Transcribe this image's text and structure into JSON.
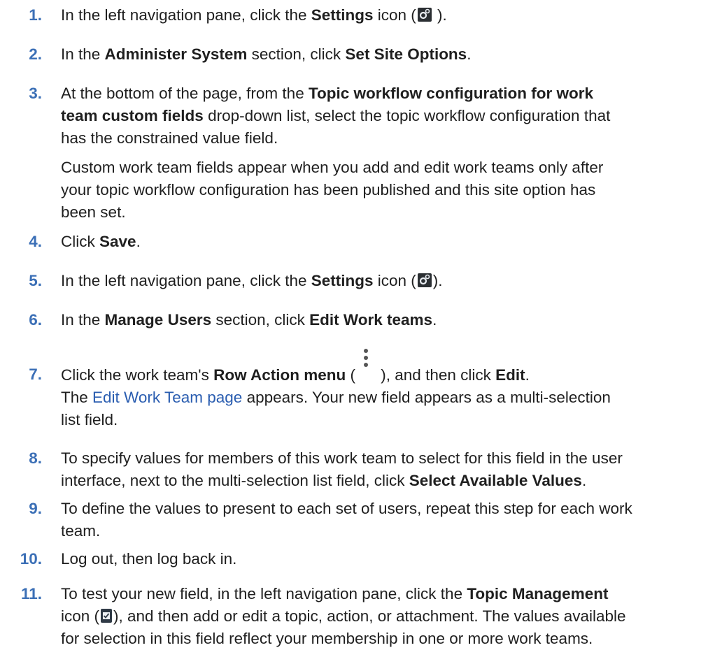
{
  "steps": [
    {
      "num": "1.",
      "parts": [
        "In the left navigation pane, click the ",
        "Settings",
        " icon (",
        " )."
      ]
    },
    {
      "num": "2.",
      "parts": [
        "In the ",
        "Administer System",
        " section, click ",
        "Set Site Options",
        "."
      ]
    },
    {
      "num": "3.",
      "line1": [
        "At the bottom of the page, from the ",
        "Topic workflow configuration for work"
      ],
      "line2": [
        "team custom fields",
        " drop-down list, select the topic workflow configuration that"
      ],
      "line3": "has the constrained value field.",
      "note": [
        "Custom work team fields appear when you add and edit work teams only after",
        "your topic workflow configuration has been published and this site option has",
        "been set."
      ]
    },
    {
      "num": "4.",
      "parts": [
        "Click ",
        "Save",
        "."
      ]
    },
    {
      "num": "5.",
      "parts": [
        "In the left navigation pane, click the ",
        "Settings",
        " icon (",
        ")."
      ]
    },
    {
      "num": "6.",
      "parts": [
        "In the ",
        "Manage Users",
        " section, click ",
        "Edit Work teams",
        "."
      ]
    },
    {
      "num": "7.",
      "parts": [
        "Click the work team's ",
        "Row Action menu",
        " (",
        " ), and then click ",
        "Edit",
        "."
      ],
      "after": [
        "The ",
        "Edit Work Team page",
        " appears. Your new field appears as a multi-selection"
      ],
      "after2": "list field."
    },
    {
      "num": "8.",
      "line1": "To specify values for members of this work team to select for this field in the user",
      "line2": [
        "interface, next to the multi-selection list field, click ",
        "Select Available Values",
        "."
      ]
    },
    {
      "num": "9.",
      "line1": "To define the values to present to each set of users, repeat this step for each work",
      "line2": "team."
    },
    {
      "num": "10.",
      "line1": "Log out, then log back in."
    },
    {
      "num": "11.",
      "line1": [
        "To test your new field, in the left navigation pane, click the ",
        "Topic Management"
      ],
      "line2": [
        "icon (",
        "), and then add or edit a topic, action, or attachment. The values available"
      ],
      "line3": "for selection in this field reflect your membership in one or more work teams."
    }
  ],
  "icons": {
    "settings": "gear-icon",
    "row_action": "kebab-menu-icon",
    "topic_management": "topic-management-icon"
  },
  "colors": {
    "step_number": "#3b6fb6",
    "link": "#2a5db0"
  }
}
